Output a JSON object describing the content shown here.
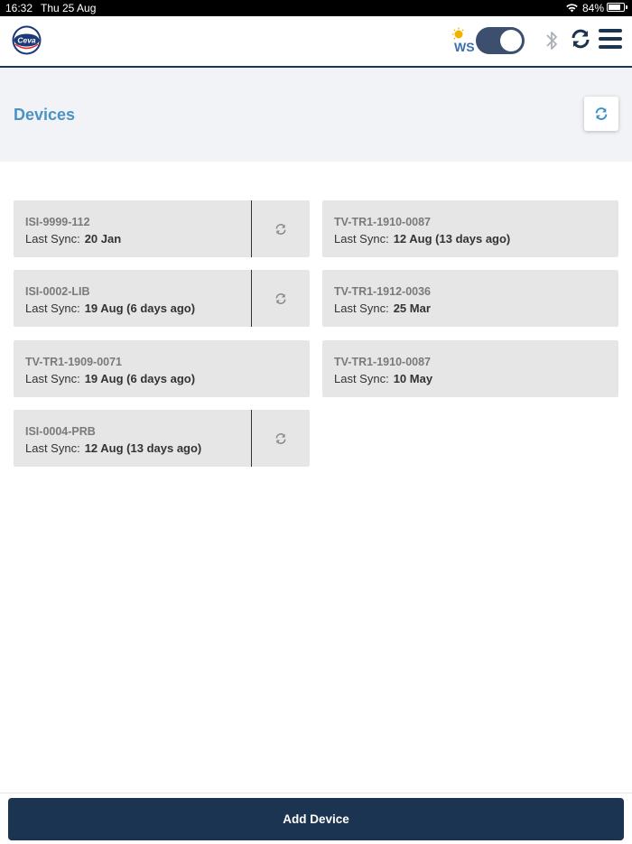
{
  "status_bar": {
    "time": "16:32",
    "date": "Thu 25 Aug",
    "battery_pct": "84%",
    "battery_level": 0.84
  },
  "header": {
    "logo_text": "Ceva",
    "ws_label": "WS",
    "toggle_on": true,
    "icons": [
      "bluetooth-icon",
      "sync-icon",
      "menu-icon"
    ]
  },
  "page": {
    "title": "Devices"
  },
  "devices": [
    {
      "name": "ISI-9999-112",
      "sync_label": "Last Sync:",
      "sync_value": "20 Jan",
      "has_sync_button": true
    },
    {
      "name": "TV-TR1-1910-0087",
      "sync_label": "Last Sync:",
      "sync_value": "12 Aug (13 days ago)",
      "has_sync_button": false
    },
    {
      "name": "ISI-0002-LIB",
      "sync_label": "Last Sync:",
      "sync_value": "19 Aug (6 days ago)",
      "has_sync_button": true
    },
    {
      "name": "TV-TR1-1912-0036",
      "sync_label": "Last Sync:",
      "sync_value": "25 Mar",
      "has_sync_button": false
    },
    {
      "name": "TV-TR1-1909-0071",
      "sync_label": "Last Sync:",
      "sync_value": "19 Aug (6 days ago)",
      "has_sync_button": false
    },
    {
      "name": "TV-TR1-1910-0087",
      "sync_label": "Last Sync:",
      "sync_value": "10 May",
      "has_sync_button": false
    },
    {
      "name": "ISI-0004-PRB",
      "sync_label": "Last Sync:",
      "sync_value": "12 Aug (13 days ago)",
      "has_sync_button": true
    }
  ],
  "footer": {
    "add_button_label": "Add Device"
  },
  "colors": {
    "brand_navy": "#1b3452",
    "title_blue": "#4a93c4",
    "card_bg": "#e6e6e6"
  }
}
